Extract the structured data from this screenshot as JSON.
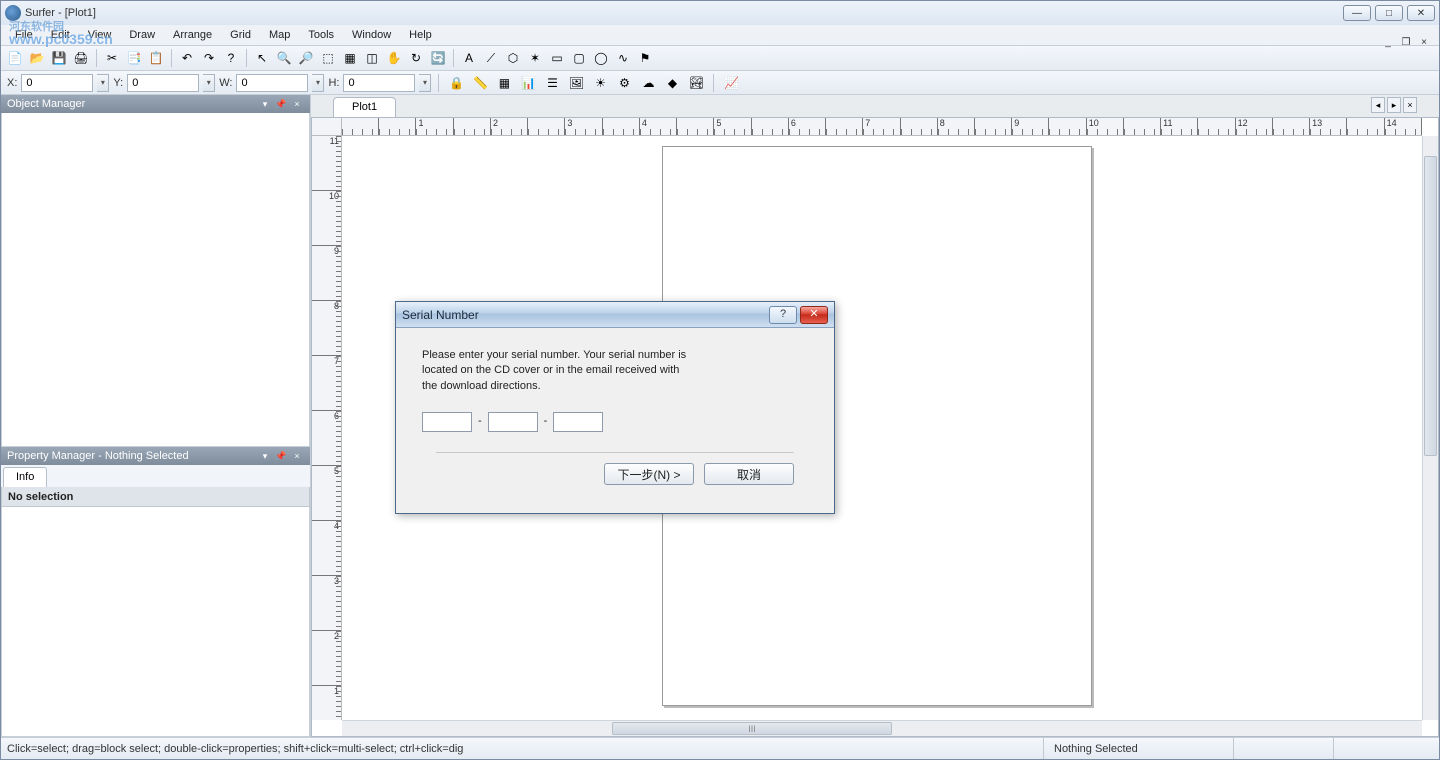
{
  "window": {
    "title": "Surfer - [Plot1]"
  },
  "watermark": {
    "text": "河东软件园",
    "url": "www.pc0359.cn"
  },
  "menus": [
    "File",
    "Edit",
    "View",
    "Draw",
    "Arrange",
    "Grid",
    "Map",
    "Tools",
    "Window",
    "Help"
  ],
  "coords": {
    "x_label": "X:",
    "x_val": "0",
    "y_label": "Y:",
    "y_val": "0",
    "w_label": "W:",
    "w_val": "0",
    "h_label": "H:",
    "h_val": "0"
  },
  "panels": {
    "object_mgr": "Object Manager",
    "prop_mgr": "Property Manager - Nothing Selected",
    "info_tab": "Info",
    "no_selection": "No selection"
  },
  "doc": {
    "tab": "Plot1"
  },
  "ruler_h": [
    "",
    "",
    "1",
    "",
    "2",
    "",
    "3",
    "",
    "4",
    "",
    "5",
    "",
    "6",
    "",
    "7",
    "",
    "8",
    "",
    "9",
    "",
    "10",
    "",
    "11",
    "",
    "12",
    "",
    "13",
    "",
    "14"
  ],
  "ruler_v": [
    "11",
    "10",
    "9",
    "8",
    "7",
    "6",
    "5",
    "4",
    "3",
    "2",
    "1"
  ],
  "scroll_thumb": "III",
  "status": {
    "hint": "Click=select;  drag=block select;  double-click=properties;  shift+click=multi-select;  ctrl+click=dig",
    "sel": "Nothing Selected"
  },
  "dialog": {
    "title": "Serial Number",
    "line1": "Please enter your serial number.  Your serial number is",
    "line2": "located on the CD cover or in the email received with",
    "line3": "the download directions.",
    "dash": "-",
    "next": "下一步(N) >",
    "cancel": "取消",
    "help": "?",
    "close": "✕"
  },
  "winbtns": {
    "min": "—",
    "max": "□",
    "close": "✕"
  },
  "mdi": {
    "min": "_",
    "restore": "❐",
    "close": "×"
  },
  "icons": {
    "new": "📄",
    "open": "📂",
    "save": "💾",
    "print": "🖨",
    "copy": "📑",
    "paste": "📋",
    "cut": "✂",
    "undo": "↶",
    "redo": "↷",
    "help": "?",
    "pointer": "↖",
    "zoomin": "🔍",
    "zoomout": "🔎",
    "zoomrect": "⬚",
    "zoomfit": "▦",
    "zoomsel": "◫",
    "pan": "✋",
    "refresh": "↻",
    "redraw": "🔄",
    "text": "A",
    "polyline": "⟋",
    "polygon": "⬡",
    "symbol": "✶",
    "rect": "▭",
    "roundrect": "▢",
    "ellipse": "◯",
    "spline": "∿",
    "flag": "⚑",
    "lock": "🔒",
    "ruler": "📏",
    "grid": "▦",
    "chart": "📊",
    "layers": "☰",
    "img": "🖼",
    "sun": "☀",
    "wiz": "⚙",
    "cloud": "☁",
    "diamond": "◆",
    "pic": "🏞",
    "bar": "📈"
  }
}
